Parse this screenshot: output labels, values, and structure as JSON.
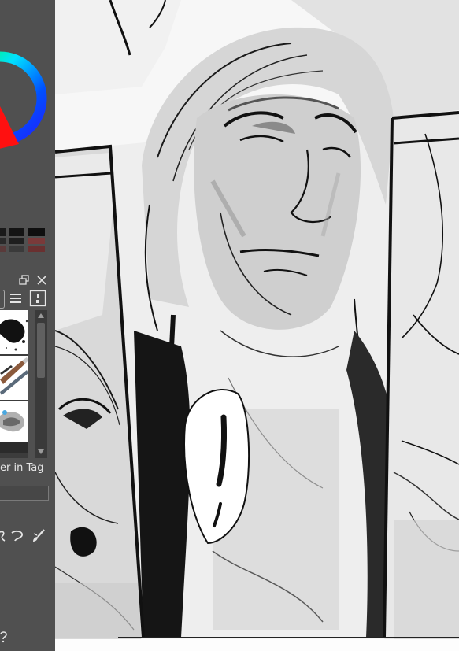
{
  "app": {
    "panel_close_icon": "close-icon",
    "panel_popout_icon": "popout-icon"
  },
  "color_panel": {
    "wheel": "hue-color-wheel",
    "selected_color": "#ff0000",
    "swatches": [
      "#1a1a1a",
      "#141414",
      "#0f0f0f",
      "#2a2a2a",
      "#1e1e1e",
      "#7a3a3a",
      "#5a3a3a",
      "#3a3a3a",
      "#6a3030"
    ]
  },
  "brush_panel": {
    "footer_label": "er in Tag",
    "menu_icon": "menu-icon",
    "settings_icon": "settings-icon",
    "scroll_up_icon": "scroll-up-icon",
    "scroll_down_icon": "scroll-down-icon"
  },
  "tools": {
    "icons": [
      "lasso-icon",
      "hook-icon",
      "paintbrush-icon"
    ],
    "help_icon": "help-icon"
  },
  "canvas": {
    "speech_bubble_text": "!",
    "accent": "#000000"
  }
}
